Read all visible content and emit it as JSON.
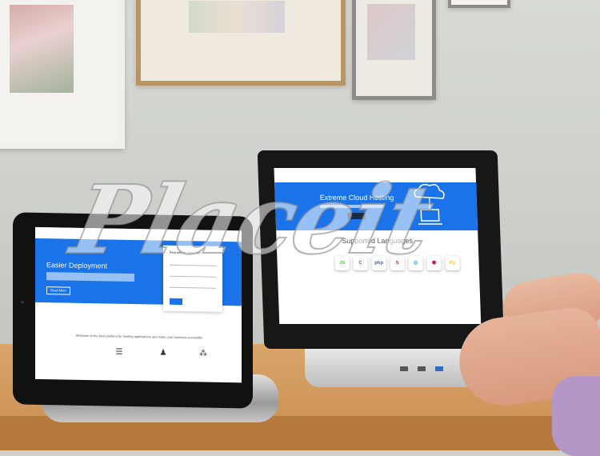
{
  "watermark": {
    "text": "Placeit"
  },
  "tablet_screen": {
    "hero_title": "Easier Deployment",
    "button_label": "Read More",
    "form_title": "Request for more info",
    "caption": "Welcome to the best platform for hosting applications and make your business accessible"
  },
  "laptop_screen": {
    "hero_title": "Extreme Cloud Hosting",
    "button_label": "Read More",
    "languages_title": "Supported Languages",
    "languages": [
      {
        "label": "JS",
        "color": "#6cc24a"
      },
      {
        "label": "C",
        "color": "#8e44ad"
      },
      {
        "label": "php",
        "color": "#4f5b93"
      },
      {
        "label": "S",
        "color": "#cc342d"
      },
      {
        "label": "◎",
        "color": "#2e9fd8"
      },
      {
        "label": "⬢",
        "color": "#c2185b"
      },
      {
        "label": "Py",
        "color": "#f2c230"
      }
    ]
  },
  "colors": {
    "accent": "#1a73e8",
    "wood": "#c98d4f"
  }
}
